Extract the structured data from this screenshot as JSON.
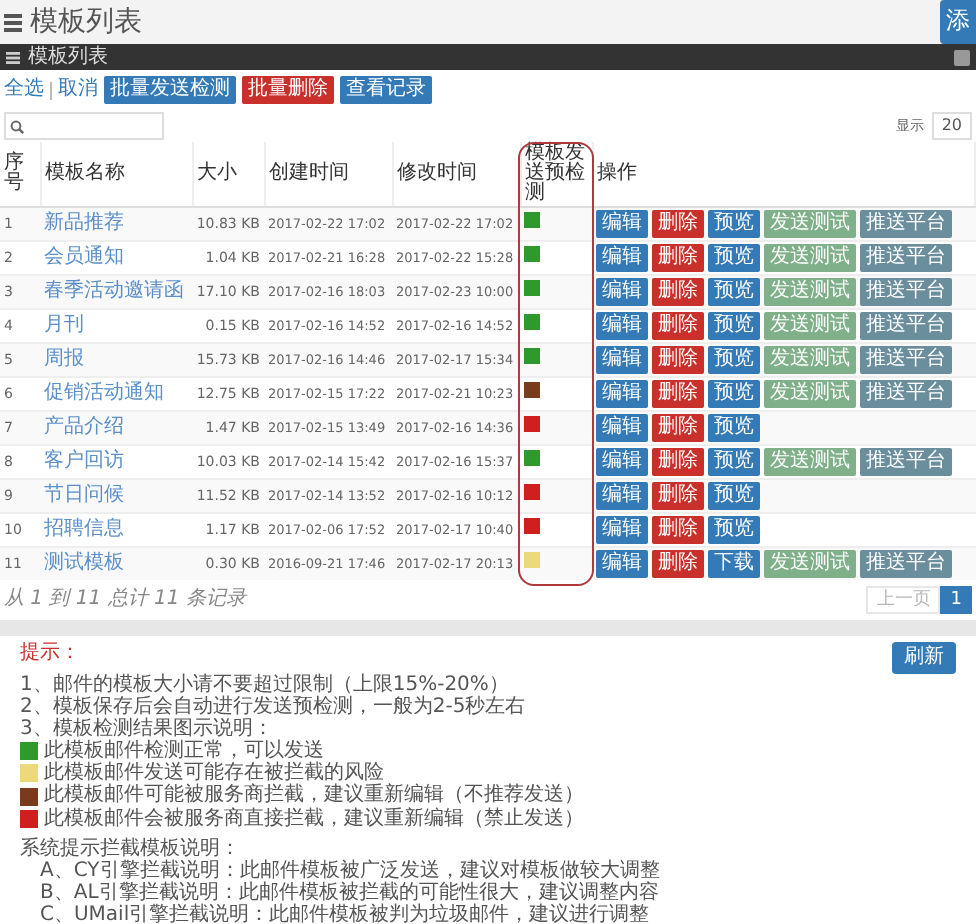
{
  "page_title": "模板列表",
  "header_button": "添",
  "panel_title": "模板列表",
  "toolbar": {
    "links": [
      "全选",
      "取消"
    ],
    "buttons": [
      {
        "label": "批量发送检测",
        "kind": "primary"
      },
      {
        "label": "批量删除",
        "kind": "danger"
      },
      {
        "label": "查看记录",
        "kind": "primary"
      }
    ]
  },
  "page_size": {
    "label": "显示",
    "value": "20"
  },
  "table": {
    "columns": [
      "序号",
      "模板名称",
      "大小",
      "创建时间",
      "修改时间",
      "模板发送预检测",
      "操作"
    ],
    "rows": [
      {
        "index": "1",
        "name": "新品推荐",
        "size": "10.83 KB",
        "created": "2017-02-22 17:02",
        "modified": "2017-02-22 17:02",
        "color": "#2e9a2e",
        "actions": [
          {
            "label": "编辑",
            "kind": "edit"
          },
          {
            "label": "删除",
            "kind": "delete"
          },
          {
            "label": "预览",
            "kind": "edit"
          },
          {
            "label": "发送测试",
            "kind": "test"
          },
          {
            "label": "推送平台",
            "kind": "push"
          }
        ]
      },
      {
        "index": "2",
        "name": "会员通知",
        "size": "1.04 KB",
        "created": "2017-02-21 16:28",
        "modified": "2017-02-22 15:28",
        "color": "#2e9a2e",
        "actions": [
          {
            "label": "编辑",
            "kind": "edit"
          },
          {
            "label": "删除",
            "kind": "delete"
          },
          {
            "label": "预览",
            "kind": "edit"
          },
          {
            "label": "发送测试",
            "kind": "test"
          },
          {
            "label": "推送平台",
            "kind": "push"
          }
        ]
      },
      {
        "index": "3",
        "name": "春季活动邀请函",
        "size": "17.10 KB",
        "created": "2017-02-16 18:03",
        "modified": "2017-02-23 10:00",
        "color": "#2e9a2e",
        "actions": [
          {
            "label": "编辑",
            "kind": "edit"
          },
          {
            "label": "删除",
            "kind": "delete"
          },
          {
            "label": "预览",
            "kind": "edit"
          },
          {
            "label": "发送测试",
            "kind": "test"
          },
          {
            "label": "推送平台",
            "kind": "push"
          }
        ]
      },
      {
        "index": "4",
        "name": "月刊",
        "size": "0.15 KB",
        "created": "2017-02-16 14:52",
        "modified": "2017-02-16 14:52",
        "color": "#2e9a2e",
        "actions": [
          {
            "label": "编辑",
            "kind": "edit"
          },
          {
            "label": "删除",
            "kind": "delete"
          },
          {
            "label": "预览",
            "kind": "edit"
          },
          {
            "label": "发送测试",
            "kind": "test"
          },
          {
            "label": "推送平台",
            "kind": "push"
          }
        ]
      },
      {
        "index": "5",
        "name": "周报",
        "size": "15.73 KB",
        "created": "2017-02-16 14:46",
        "modified": "2017-02-17 15:34",
        "color": "#2e9a2e",
        "actions": [
          {
            "label": "编辑",
            "kind": "edit"
          },
          {
            "label": "删除",
            "kind": "delete"
          },
          {
            "label": "预览",
            "kind": "edit"
          },
          {
            "label": "发送测试",
            "kind": "test"
          },
          {
            "label": "推送平台",
            "kind": "push"
          }
        ]
      },
      {
        "index": "6",
        "name": "促销活动通知",
        "size": "12.75 KB",
        "created": "2017-02-15 17:22",
        "modified": "2017-02-21 10:23",
        "color": "#7a3a1c",
        "actions": [
          {
            "label": "编辑",
            "kind": "edit"
          },
          {
            "label": "删除",
            "kind": "delete"
          },
          {
            "label": "预览",
            "kind": "edit"
          },
          {
            "label": "发送测试",
            "kind": "test"
          },
          {
            "label": "推送平台",
            "kind": "push"
          }
        ]
      },
      {
        "index": "7",
        "name": "产品介绍",
        "size": "1.47 KB",
        "created": "2017-02-15 13:49",
        "modified": "2017-02-16 14:36",
        "color": "#d01f1f",
        "actions": [
          {
            "label": "编辑",
            "kind": "edit"
          },
          {
            "label": "删除",
            "kind": "delete"
          },
          {
            "label": "预览",
            "kind": "edit"
          }
        ]
      },
      {
        "index": "8",
        "name": "客户回访",
        "size": "10.03 KB",
        "created": "2017-02-14 15:42",
        "modified": "2017-02-16 15:37",
        "color": "#2e9a2e",
        "actions": [
          {
            "label": "编辑",
            "kind": "edit"
          },
          {
            "label": "删除",
            "kind": "delete"
          },
          {
            "label": "预览",
            "kind": "edit"
          },
          {
            "label": "发送测试",
            "kind": "test"
          },
          {
            "label": "推送平台",
            "kind": "push"
          }
        ]
      },
      {
        "index": "9",
        "name": "节日问候",
        "size": "11.52 KB",
        "created": "2017-02-14 13:52",
        "modified": "2017-02-16 10:12",
        "color": "#d01f1f",
        "actions": [
          {
            "label": "编辑",
            "kind": "edit"
          },
          {
            "label": "删除",
            "kind": "delete"
          },
          {
            "label": "预览",
            "kind": "edit"
          }
        ]
      },
      {
        "index": "10",
        "name": "招聘信息",
        "size": "1.17 KB",
        "created": "2017-02-06 17:52",
        "modified": "2017-02-17 10:40",
        "color": "#d01f1f",
        "actions": [
          {
            "label": "编辑",
            "kind": "edit"
          },
          {
            "label": "删除",
            "kind": "delete"
          },
          {
            "label": "预览",
            "kind": "edit"
          }
        ]
      },
      {
        "index": "11",
        "name": "测试模板",
        "size": "0.30 KB",
        "created": "2016-09-21 17:46",
        "modified": "2017-02-17 20:13",
        "color": "#ecd97a",
        "actions": [
          {
            "label": "编辑",
            "kind": "edit"
          },
          {
            "label": "删除",
            "kind": "delete"
          },
          {
            "label": "下载",
            "kind": "edit"
          },
          {
            "label": "发送测试",
            "kind": "test"
          },
          {
            "label": "推送平台",
            "kind": "push"
          }
        ]
      }
    ]
  },
  "footer": "从 1 到 11 总计 11 条记录",
  "pagination": [
    {
      "label": "上一页",
      "disabled": true,
      "selected": false
    },
    {
      "label": "1",
      "disabled": false,
      "selected": true
    }
  ],
  "tips": {
    "title": "提示：",
    "button": "刷新",
    "items": [
      "1、邮件的模板大小请不要超过限制（上限15%-20%）",
      "2、模板保存后会自动进行发送预检测，一般为2-5秒左右",
      "3、模板检测结果图示说明："
    ],
    "legend": [
      {
        "color": "#2e9a2e",
        "text": "此模板邮件检测正常，可以发送"
      },
      {
        "color": "#ecd97a",
        "text": "此模板邮件发送可能存在被拦截的风险"
      },
      {
        "color": "#7a3a1c",
        "text": "此模板邮件可能被服务商拦截，建议重新编辑（不推荐发送）"
      },
      {
        "color": "#d01f1f",
        "text": "此模板邮件会被服务商直接拦截，建议重新编辑（禁止发送）"
      }
    ],
    "engine_title": "系统提示拦截模板说明：",
    "engine_items": [
      "A、CY引擎拦截说明：此邮件模板被广泛发送，建议对模板做较大调整",
      "B、AL引擎拦截说明：此邮件模板被拦截的可能性很大，建议调整内容",
      "C、UMail引擎拦截说明：此邮件模板被判为垃圾邮件，建议进行调整"
    ]
  }
}
